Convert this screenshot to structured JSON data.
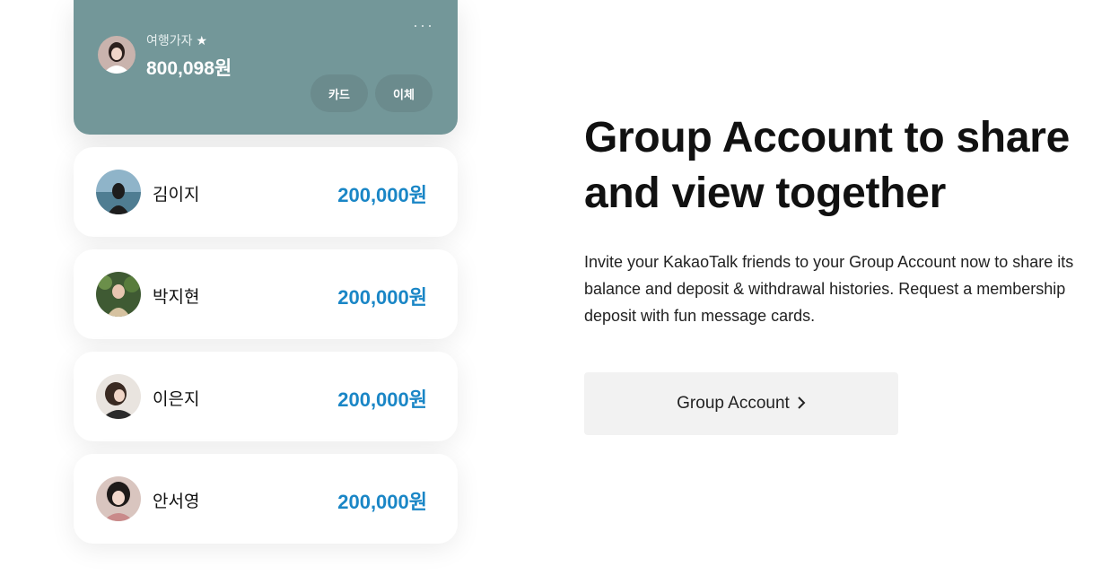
{
  "account": {
    "name": "여행가자",
    "favorite_icon": "star-icon",
    "balance": "800,098원",
    "more_icon": "more-dots-icon",
    "more_glyph": "···",
    "card_label": "카드",
    "transfer_label": "이체",
    "bg_color": "#739799"
  },
  "members": [
    {
      "name": "김이지",
      "amount": "200,000원"
    },
    {
      "name": "박지현",
      "amount": "200,000원"
    },
    {
      "name": "이은지",
      "amount": "200,000원"
    },
    {
      "name": "안서영",
      "amount": "200,000원"
    }
  ],
  "hero": {
    "title_line1": "Group Account to share",
    "title_line2": "and view together",
    "description": "Invite your KakaoTalk friends to your Group Account now to share its balance and deposit & withdrawal histories. Request a membership deposit with fun message cards.",
    "cta_label": "Group Account",
    "cta_icon": "chevron-right-icon"
  },
  "colors": {
    "amount": "#1a86c6",
    "cta_bg": "#f2f2f2"
  }
}
